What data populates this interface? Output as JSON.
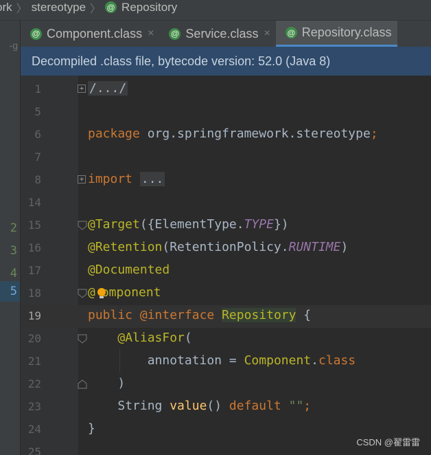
{
  "breadcrumbs": [
    "ork",
    "stereotype",
    "Repository"
  ],
  "left_strip": {
    "top_label": "-g",
    "rows": [
      "2",
      "3",
      "4",
      "5"
    ]
  },
  "tabs": [
    {
      "label": "Component.class",
      "active": false
    },
    {
      "label": "Service.class",
      "active": false
    },
    {
      "label": "Repository.class",
      "active": true
    }
  ],
  "tab_icon_glyph": "@",
  "close_glyph": "×",
  "banner": "Decompiled .class file, bytecode version: 52.0 (Java 8)",
  "lines": [
    {
      "num": "1"
    },
    {
      "num": "5"
    },
    {
      "num": "6"
    },
    {
      "num": "7"
    },
    {
      "num": "8"
    },
    {
      "num": "14"
    },
    {
      "num": "15"
    },
    {
      "num": "16"
    },
    {
      "num": "17"
    },
    {
      "num": "18"
    },
    {
      "num": "19"
    },
    {
      "num": "20"
    },
    {
      "num": "21"
    },
    {
      "num": "22"
    },
    {
      "num": "23"
    },
    {
      "num": "24"
    },
    {
      "num": "25"
    }
  ],
  "code": {
    "l1": "/.../",
    "l6_kw": "package",
    "l6_pkg": " org.springframework.stereotype",
    "l6_semi": ";",
    "l8_kw": "import",
    "l8_fold": "...",
    "l15_ann": "@Target",
    "l15_a": "({ElementType.",
    "l15_const": "TYPE",
    "l15_b": "})",
    "l16_ann": "@Retention",
    "l16_a": "(RetentionPolicy.",
    "l16_const": "RUNTIME",
    "l16_b": ")",
    "l17_ann": "@Documented",
    "l18_at": "@",
    "l18_rest": "omponent",
    "l19_kw1": "public",
    "l19_kw2": " @interface",
    "l19_name": "Repository",
    "l19_brace": " {",
    "l20_ann": "@AliasFor",
    "l20_paren": "(",
    "l21_key": "annotation = ",
    "l21_cls": "Component",
    "l21_dot": ".",
    "l21_kw": "class",
    "l22": ")",
    "l23_type": "String ",
    "l23_fn": "value",
    "l23_parens": "() ",
    "l23_kw": "default",
    "l23_str": " \"\"",
    "l23_semi": ";",
    "l24": "}"
  },
  "watermark": "CSDN @翟雷雷",
  "colors": {
    "keyword": "#cc7832",
    "annotation": "#bbb529",
    "constant": "#9876aa",
    "string": "#6a8759",
    "method": "#ffc66d",
    "banner_bg": "#2f4a6a",
    "active_tab_underline": "#4a88c7"
  }
}
